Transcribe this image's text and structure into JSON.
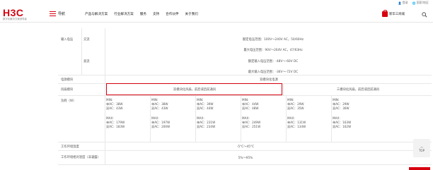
{
  "util": {
    "login": "登录",
    "region": "国家/地区"
  },
  "header": {
    "logo_text": "H3C",
    "logo_sub": "数字化解决方案领导者",
    "menu_label": "导航",
    "nav": [
      "产品与解决方案",
      "行业解决方案",
      "服务",
      "支持",
      "合作伙伴",
      "关于我们"
    ],
    "shop_label": "新华三商城"
  },
  "table": {
    "input_voltage_label": "输入电压",
    "ac_label": "交流",
    "dc_label": "直流",
    "ac_rated": "额定电压范围：100V～240V AC，50/60Hz",
    "ac_max": "最大电压范围：90V～264V AC，47/63Hz",
    "dc_rated": "额定输入电压范围：-48V～-60V DC",
    "dc_max": "最大输入电压范围：-36V～-72V DC",
    "psu_label": "电源模块",
    "psu_value": "双模块化电源",
    "fan_label": "风扇模块",
    "fan_value_a": "双模块化风扇，前后或后前通风",
    "fan_value_b": "三模块化风扇，前后或后前通风",
    "power_label": "功耗（W）",
    "power_cols": [
      {
        "min_t": "MIN:",
        "min_a": "单AC：38W",
        "min_b": "双AC：43W",
        "max_t": "MAX:",
        "max_a": "单AC：179W",
        "max_b": "双AC：183W"
      },
      {
        "min_t": "MIN:",
        "min_a": "单AC：38W",
        "min_b": "双AC：43W",
        "max_t": "MAX:",
        "max_a": "单AC：197W",
        "max_b": "双AC：200W"
      },
      {
        "min_t": "MIN:",
        "min_a": "单AC：39W",
        "min_b": "双AC：44W",
        "max_t": "MAX:",
        "max_a": "单AC：231W",
        "max_b": "双AC：234W"
      },
      {
        "min_t": "MIN:",
        "min_a": "单AC：44W",
        "min_b": "双AC：48W",
        "max_t": "MAX:",
        "max_a": "单AC：249W",
        "max_b": "双AC：251W"
      },
      {
        "min_t": "MIN:",
        "min_a": "单AC：29W",
        "min_b": "双AC：35W",
        "max_t": "MAX:",
        "max_a": "单AC：131W",
        "max_b": "双AC：134W"
      },
      {
        "min_t": "MIN:",
        "min_a": "单AC：29W",
        "min_b": "双AC：36W",
        "max_t": "MAX:",
        "max_a": "单AC：163W",
        "max_b": "双AC：162W"
      }
    ],
    "temp_label": "工作环境温度",
    "temp_value": "-5°C～45°C",
    "humidity_label": "工作环境相对湿度（非凝露）",
    "humidity_value": "5%～95%"
  },
  "top_button": "TOP"
}
